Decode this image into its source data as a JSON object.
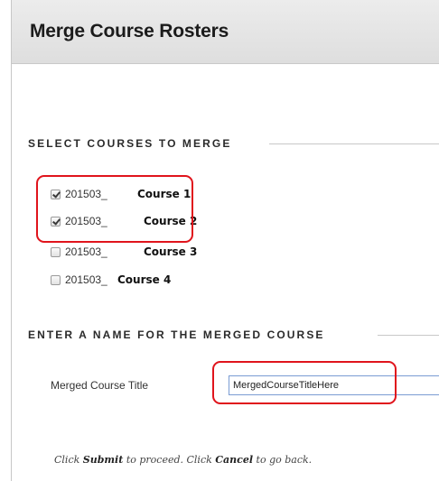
{
  "header": {
    "title": "Merge Course Rosters"
  },
  "select_section": {
    "heading": "SELECT COURSES TO MERGE",
    "courses": [
      {
        "code": "201503_",
        "name": "Course 1",
        "checked": true
      },
      {
        "code": "201503_",
        "name": "Course 2",
        "checked": true
      },
      {
        "code": "201503_",
        "name": "Course 3",
        "checked": false
      },
      {
        "code": "201503_",
        "name": "Course 4",
        "checked": false
      }
    ]
  },
  "name_section": {
    "heading": "ENTER A NAME FOR THE MERGED COURSE",
    "field_label": "Merged Course Title",
    "field_value": "MergedCourseTitleHere"
  },
  "instructions": {
    "prefix": "Click ",
    "submit_word": "Submit",
    "middle": " to proceed. Click ",
    "cancel_word": "Cancel",
    "suffix": " to go back."
  },
  "colors": {
    "annotation": "#e0141c",
    "input_border": "#7a9cd3"
  }
}
